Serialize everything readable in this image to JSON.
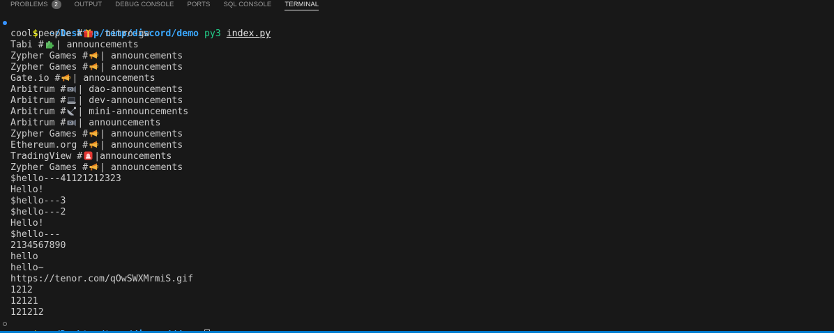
{
  "panel": {
    "tabs": [
      {
        "label": "PROBLEMS",
        "badge": "2"
      },
      {
        "label": "OUTPUT"
      },
      {
        "label": "DEBUG CONSOLE"
      },
      {
        "label": "PORTS"
      },
      {
        "label": "SQL CONSOLE"
      },
      {
        "label": "TERMINAL",
        "active": true
      }
    ]
  },
  "terminal": {
    "prompt_symbol": "$",
    "cwd": "~/Desktop/temp/discord/demo",
    "command": {
      "program": "py3",
      "argument": "index.py"
    },
    "channels": [
      {
        "prefix": "cool-people #",
        "icon": "gift-icon",
        "suffix": "· nitro-gw"
      },
      {
        "prefix": "Tabi #",
        "icon": "puzzle-icon",
        "suffix": "| announcements"
      },
      {
        "prefix": "Zypher Games #",
        "icon": "megaphone-icon",
        "suffix": "| announcements"
      },
      {
        "prefix": "Zypher Games #",
        "icon": "megaphone-icon",
        "suffix": "| announcements"
      },
      {
        "prefix": "Gate.io #",
        "icon": "megaphone-icon",
        "suffix": "| announcements"
      },
      {
        "prefix": "Arbitrum #",
        "icon": "projector-icon",
        "suffix": "| dao-announcements"
      },
      {
        "prefix": "Arbitrum #",
        "icon": "laptop-icon",
        "suffix": "| dev-announcements"
      },
      {
        "prefix": "Arbitrum #",
        "icon": "satellite-icon",
        "suffix": "| mini-announcements"
      },
      {
        "prefix": "Arbitrum #",
        "icon": "projector-icon",
        "suffix": "| announcements"
      },
      {
        "prefix": "Zypher Games #",
        "icon": "megaphone-icon",
        "suffix": "| announcements"
      },
      {
        "prefix": "Ethereum.org #",
        "icon": "megaphone-icon",
        "suffix": "| announcements"
      },
      {
        "prefix": "TradingView #",
        "icon": "siren-icon",
        "suffix": "|announcements"
      },
      {
        "prefix": "Zypher Games #",
        "icon": "megaphone-icon",
        "suffix": "| announcements"
      }
    ],
    "output_lines": [
      "$hello---41121212323",
      "Hello!",
      "$hello---3",
      "$hello---2",
      "Hello!",
      "$hello---",
      "2134567890",
      "hello",
      "hello~",
      "https://tenor.com/qOwSWXMrmiS.gif",
      "1212",
      "12121",
      "121212"
    ]
  }
}
